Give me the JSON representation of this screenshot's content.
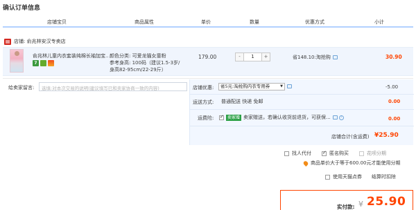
{
  "page": {
    "title": "确认订单信息"
  },
  "table_header": {
    "columns": [
      "店铺宝贝",
      "商品属性",
      "单价",
      "数量",
      "优惠方式",
      "小计"
    ]
  },
  "shop": {
    "label": "店铺: 俞兆林安汉专卖店"
  },
  "item": {
    "name": "俞兆林儿童内衣套装纯棉长袖加宝...",
    "attr_color": "颜色分类: 可爱龙猫女童粉",
    "attr_size": "参考身高: 100码（建议1.5-3岁/",
    "attr_size2": "身高82-95cm/22-29斤）",
    "badge_text": "7",
    "price": "179.00",
    "quantity": "1",
    "qty_minus": "-",
    "qty_plus": "+",
    "promo": "省148.10:淘抢购",
    "subtotal": "30.90"
  },
  "message": {
    "label": "给卖家留言:",
    "placeholder": "选填:对本次交易的说明(建议填写已和卖家协商一致的内容)"
  },
  "discount": {
    "label": "店铺优惠:",
    "selected": "省5元:淘抢购内衣专用券",
    "value": "-5.00"
  },
  "shipping": {
    "label": "运送方式:",
    "method": "普通配送 快递 免邮",
    "value": "0.00"
  },
  "insurance": {
    "label": "运费险:",
    "tag": "卖家赠",
    "text": "卖家赠送，若确认收货前退货，可获保...",
    "value": "0.00"
  },
  "shop_total": {
    "label": "店铺合计(含运费)",
    "value": "¥25.90"
  },
  "options": {
    "proxy": "找人代付",
    "anonymous": "匿名购买",
    "huabei": "花呗分期",
    "huabei_note": "商品单价大于等于600.00元才能使用分期"
  },
  "coupon": {
    "tmall": "使用天猫点券",
    "credit_card": "结算时扣除"
  },
  "payment": {
    "label": "实付款:",
    "currency": "¥",
    "value": "25.90"
  },
  "colors": {
    "accent": "#ff4400",
    "header_line": "#b2d1ff",
    "panel_bg": "#f2f7ff"
  }
}
